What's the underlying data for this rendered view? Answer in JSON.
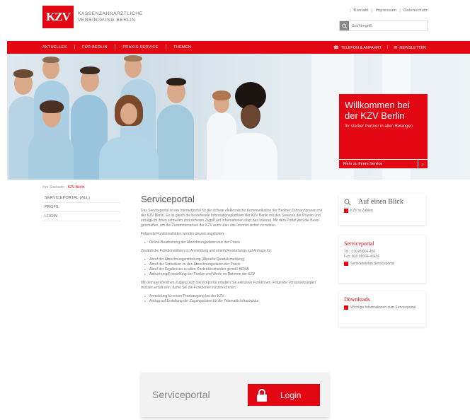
{
  "header": {
    "logo_mark": "KZV",
    "logo_line1": "Kassenzahnärztliche",
    "logo_line2": "Vereinigung Berlin",
    "top_links": [
      "Kontakt",
      "Impressum",
      "Datenschutz"
    ],
    "search_placeholder": "Suchbegriff"
  },
  "nav": {
    "items": [
      "Aktuelles",
      "Für Berlin",
      "Praxis-Service",
      "Themen"
    ],
    "right": [
      "Telefon & Anfahrt",
      "Newsletter"
    ]
  },
  "hero": {
    "welcome_title": "Willkommen bei der KZV Berlin",
    "welcome_text": "Ihr starker Partner in allen Belangen",
    "welcome_cta": "Mehr zu Ihrem Service"
  },
  "breadcrumb": {
    "home": "Ihre Startseite",
    "current": "KZV Berlin"
  },
  "subnav": {
    "items": [
      "Serviceportal (ALL)",
      "Profil",
      "Login"
    ]
  },
  "main": {
    "title": "Serviceportal",
    "para1": "Das Serviceportal ist ein Internetportal für die sichere elektronische Kommunikation der Berliner Zahnarztpraxen mit der KZV Berlin. Es ist gleich die bestehende Informationsplattform der KZV Berlin mit den Services der Praxen und ermöglicht ihnen schnellen und sicheren Zugriff auf Informationen über das Internet. Mit dem Portal wird die Basis geschaffen, um die Zusammenarbeit der KZV auch über das Internet sicher zu nutzen.",
    "para2": "Folgende Funktionalitäten werden derzeit angeboten:",
    "list1": [
      "Online-Bearbeitung der Abrechnungsdaten aus der Praxis"
    ],
    "para3": "Zusätzliche Funktionalitäten im Anmeldung und einem Freistellungs auf Anfrage für:",
    "list2": [
      "Abruf der Abrechnungsmitteilung (Aktuelle Quartalsmeldung)",
      "Abruf der Statistiken zu den Abrechnungsdaten der Praxis",
      "Abruf der Ergebnisse zu allen Kostenbescheiden gemäß BEMA",
      "Abbuchung/Freistellung der Punkte und Werte im Rahmen der KZV"
    ],
    "para4": "Mit dem persönlichen Zugang zum Serviceportal erhalten Sie exklusive Funktionen. Folgende Voraussetzungen müssen erfüllt sein, damit Sie die Funktionen nutzen können:",
    "list3": [
      "Anmeldung für einen Praxiszugang bei der KZV",
      "Antrag auf Erstellung der Zugangsdaten für die Telematik-Infrastruktur"
    ]
  },
  "login_box": {
    "label": "Serviceportal",
    "button": "Login"
  },
  "sidebar": {
    "glance_title": "Auf einen Blick",
    "glance_link": "KZV in Zahlen",
    "service_title": "Serviceportal",
    "service_tel": "Tel.: 030 89004-456",
    "service_fax": "Fax: 030 89004-46456",
    "service_link": "Servicetelefon Serviceportal",
    "downloads_title": "Downloads",
    "downloads_link": "Wichtige Informationen zum Serviceportal"
  },
  "colors": {
    "brand_red": "#e30613",
    "text_gray": "#555555"
  }
}
